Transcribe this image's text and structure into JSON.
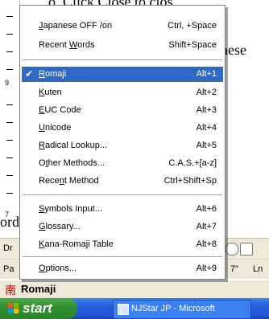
{
  "background": {
    "ruler_numbers": [
      "9",
      "7"
    ],
    "doc_text_top": "o, Click Close to clos",
    "doc_text_right": "nese",
    "doc_text_left": "ord",
    "draw_label": "Dr",
    "status_left": "Pa",
    "status_mid": "7\"",
    "status_right": "Ln"
  },
  "ime_bar": {
    "logo": "南",
    "mode": "Romaji"
  },
  "taskbar": {
    "start": "start",
    "task": "NJStar JP - Microsoft"
  },
  "menu": {
    "items": [
      {
        "prefix": "",
        "u": "J",
        "rest": "apanese OFF /on",
        "shortcut": "Ctrl, +Space"
      },
      {
        "prefix": "Recent ",
        "u": "W",
        "rest": "ords",
        "shortcut": "Shift+Space"
      },
      {
        "prefix": "",
        "u": "R",
        "rest": "omaji",
        "shortcut": "Alt+1",
        "checked": true,
        "selected": true
      },
      {
        "prefix": "",
        "u": "K",
        "rest": "uten",
        "shortcut": "Alt+2"
      },
      {
        "prefix": "",
        "u": "E",
        "rest": "UC Code",
        "shortcut": "Alt+3"
      },
      {
        "prefix": "",
        "u": "U",
        "rest": "nicode",
        "shortcut": "Alt+4"
      },
      {
        "prefix": "",
        "u": "R",
        "rest": "adical Lookup...",
        "shortcut": "Alt+5"
      },
      {
        "prefix": "O",
        "u": "t",
        "rest": "her Methods...",
        "shortcut": "C.A.S.+[a-z]"
      },
      {
        "prefix": "Rece",
        "u": "n",
        "rest": "t Method",
        "shortcut": "Ctrl+Shift+Sp"
      },
      {
        "prefix": "",
        "u": "S",
        "rest": "ymbols Input...",
        "shortcut": "Alt+6"
      },
      {
        "prefix": "",
        "u": "G",
        "rest": "lossary...",
        "shortcut": "Alt+7"
      },
      {
        "prefix": "",
        "u": "K",
        "rest": "ana-Romaji Table",
        "shortcut": "Alt+8"
      },
      {
        "prefix": "",
        "u": "O",
        "rest": "ptions...",
        "shortcut": "Alt+9"
      }
    ],
    "check_mark": "✔"
  },
  "colors": {
    "selection": "#316ac5",
    "taskbar": "#245edb",
    "start": "#2f8f2f"
  }
}
